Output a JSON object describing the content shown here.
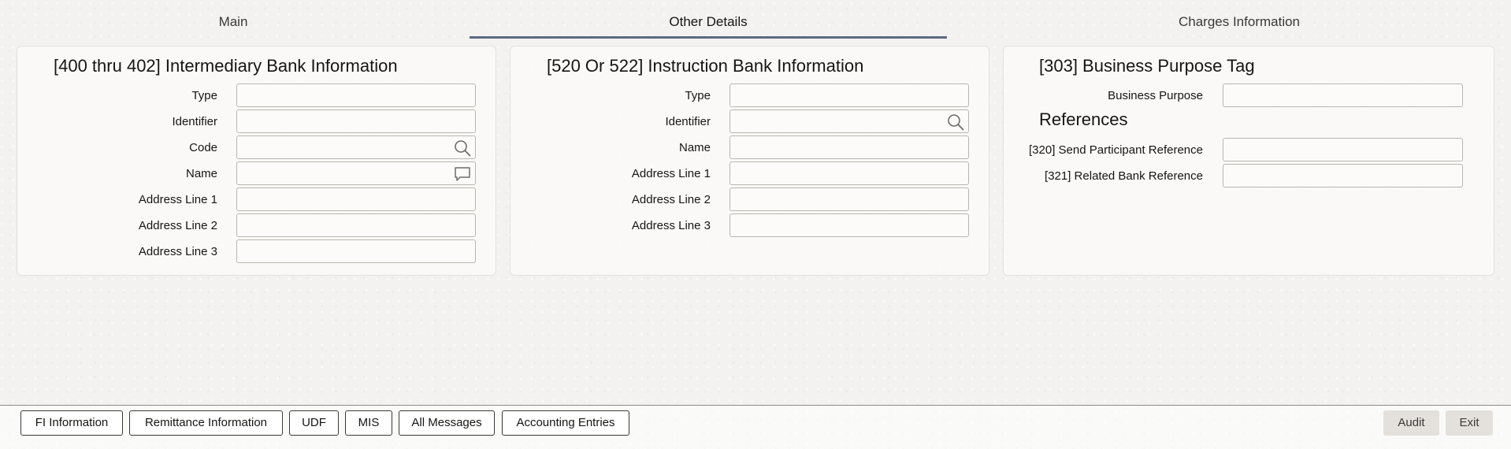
{
  "tabs": [
    {
      "label": "Main",
      "active": false
    },
    {
      "label": "Other Details",
      "active": true
    },
    {
      "label": "Charges Information",
      "active": false
    }
  ],
  "intermediary": {
    "title": "[400 thru 402] Intermediary Bank Information",
    "fields": [
      {
        "label": "Type",
        "value": "",
        "icon": ""
      },
      {
        "label": "Identifier",
        "value": "",
        "icon": ""
      },
      {
        "label": "Code",
        "value": "",
        "icon": "search-icon"
      },
      {
        "label": "Name",
        "value": "",
        "icon": "comment-icon"
      },
      {
        "label": "Address Line 1",
        "value": "",
        "icon": ""
      },
      {
        "label": "Address Line 2",
        "value": "",
        "icon": ""
      },
      {
        "label": "Address Line 3",
        "value": "",
        "icon": ""
      }
    ]
  },
  "instruction": {
    "title": "[520 Or 522] Instruction Bank Information",
    "fields": [
      {
        "label": "Type",
        "value": "",
        "icon": ""
      },
      {
        "label": "Identifier",
        "value": "",
        "icon": "search-icon"
      },
      {
        "label": "Name",
        "value": "",
        "icon": ""
      },
      {
        "label": "Address Line 1",
        "value": "",
        "icon": ""
      },
      {
        "label": "Address Line 2",
        "value": "",
        "icon": ""
      },
      {
        "label": "Address Line 3",
        "value": "",
        "icon": ""
      }
    ]
  },
  "business": {
    "title": "[303] Business Purpose Tag",
    "fields": [
      {
        "label": "Business Purpose",
        "value": ""
      }
    ],
    "references_title": "References",
    "references": [
      {
        "label": "[320] Send Participant Reference",
        "value": ""
      },
      {
        "label": "[321] Related Bank Reference",
        "value": ""
      }
    ]
  },
  "footer": {
    "left_buttons": [
      "FI Information",
      "Remittance Information",
      "UDF",
      "MIS",
      "All Messages",
      "Accounting Entries"
    ],
    "right_buttons": [
      "Audit",
      "Exit"
    ]
  },
  "colors": {
    "accent_underline": "#5d6b80",
    "panel_bg": "#fbfaf8",
    "field_border": "#b9b6b0"
  }
}
